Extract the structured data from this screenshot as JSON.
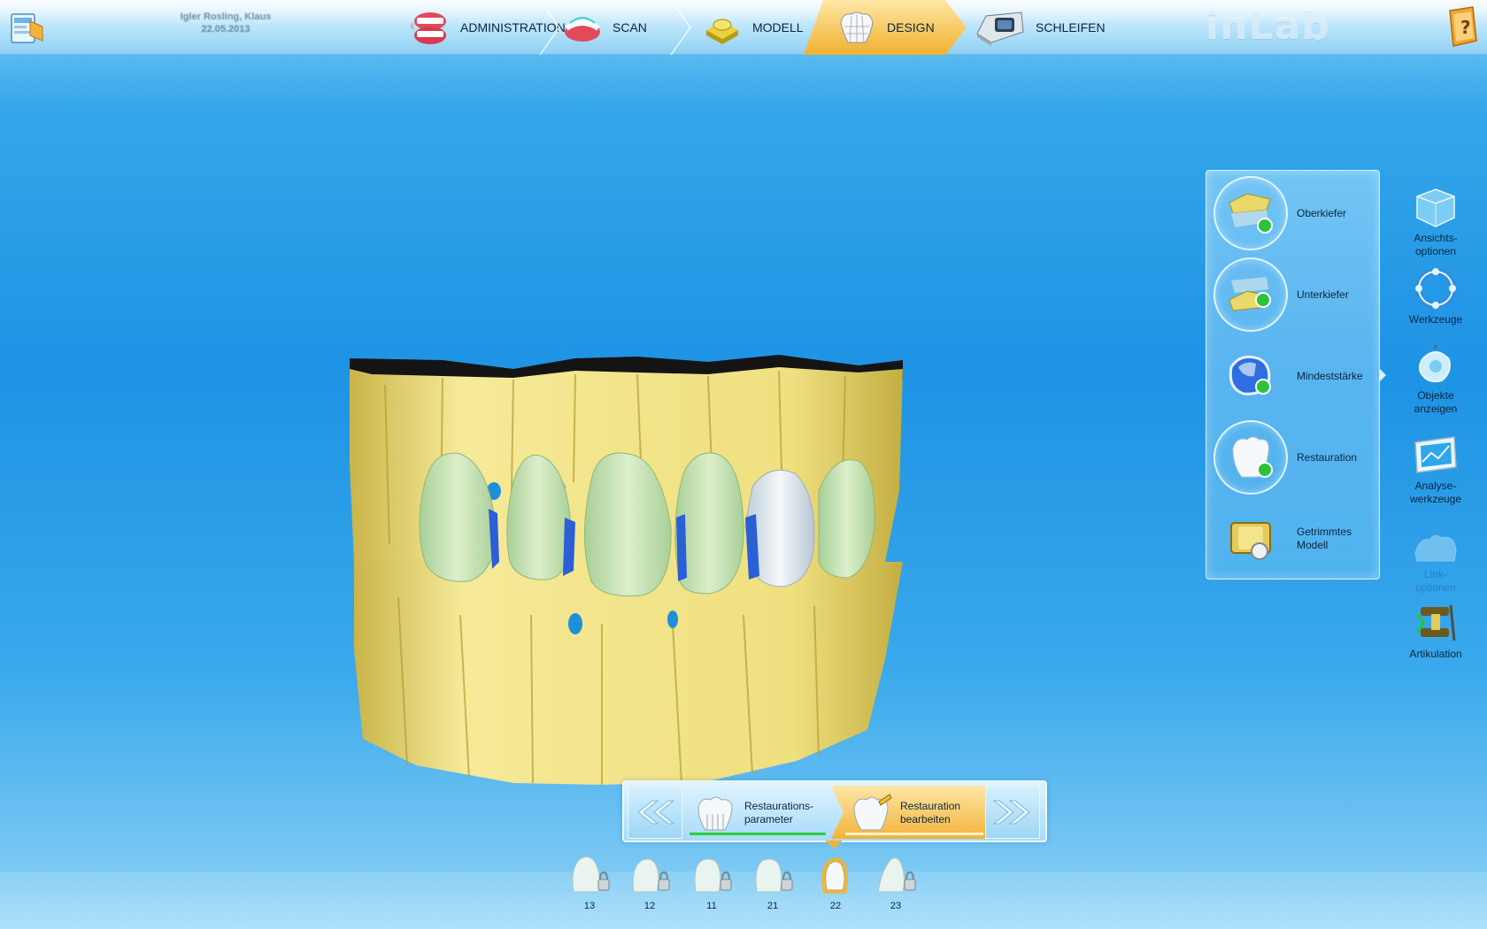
{
  "patient": {
    "name": "Igler Rosling, Klaus",
    "date": "22.05.2013"
  },
  "logo": "inLab",
  "steps": [
    {
      "label": "ADMINISTRATION",
      "icon": "dentures-icon"
    },
    {
      "label": "SCAN",
      "icon": "scan-jaw-icon"
    },
    {
      "label": "MODELL",
      "icon": "model-base-icon"
    },
    {
      "label": "DESIGN",
      "icon": "crown-mesh-icon",
      "active": true
    },
    {
      "label": "SCHLEIFEN",
      "icon": "milling-unit-icon"
    }
  ],
  "model_panel": [
    {
      "label": "Oberkiefer",
      "icon": "upper-jaw-icon"
    },
    {
      "label": "Unterkiefer",
      "icon": "lower-jaw-icon"
    },
    {
      "label": "Mindeststärke",
      "icon": "min-thickness-icon"
    },
    {
      "label": "Restauration",
      "icon": "restoration-icon"
    },
    {
      "label": "Getrimmtes\nModell",
      "label_l1": "Getrimmtes",
      "label_l2": "Modell",
      "icon": "trimmed-model-icon"
    }
  ],
  "right_tools": [
    {
      "l1": "Ansichts-",
      "l2": "optionen",
      "icon": "view-cube-icon"
    },
    {
      "l1": "Werkzeuge",
      "l2": "",
      "icon": "tools-ring-icon"
    },
    {
      "l1": "Objekte",
      "l2": "anzeigen",
      "icon": "show-objects-icon"
    },
    {
      "l1": "Analyse-",
      "l2": "werkzeuge",
      "icon": "analysis-tools-icon"
    },
    {
      "l1": "Link-",
      "l2": "optionen",
      "icon": "link-options-icon",
      "disabled": true
    },
    {
      "l1": "Artikulation",
      "l2": "",
      "icon": "articulator-icon"
    }
  ],
  "workflow": {
    "step1": {
      "l1": "Restaurations-",
      "l2": "parameter"
    },
    "step2": {
      "l1": "Restauration",
      "l2": "bearbeiten"
    }
  },
  "teeth": [
    "13",
    "12",
    "11",
    "21",
    "22",
    "23"
  ],
  "selected_tooth": "22",
  "colors": {
    "accent": "#f3b42e",
    "progress": "#2ccf3a",
    "model": "#f2e48a",
    "restoration": "#cfe9bf"
  }
}
